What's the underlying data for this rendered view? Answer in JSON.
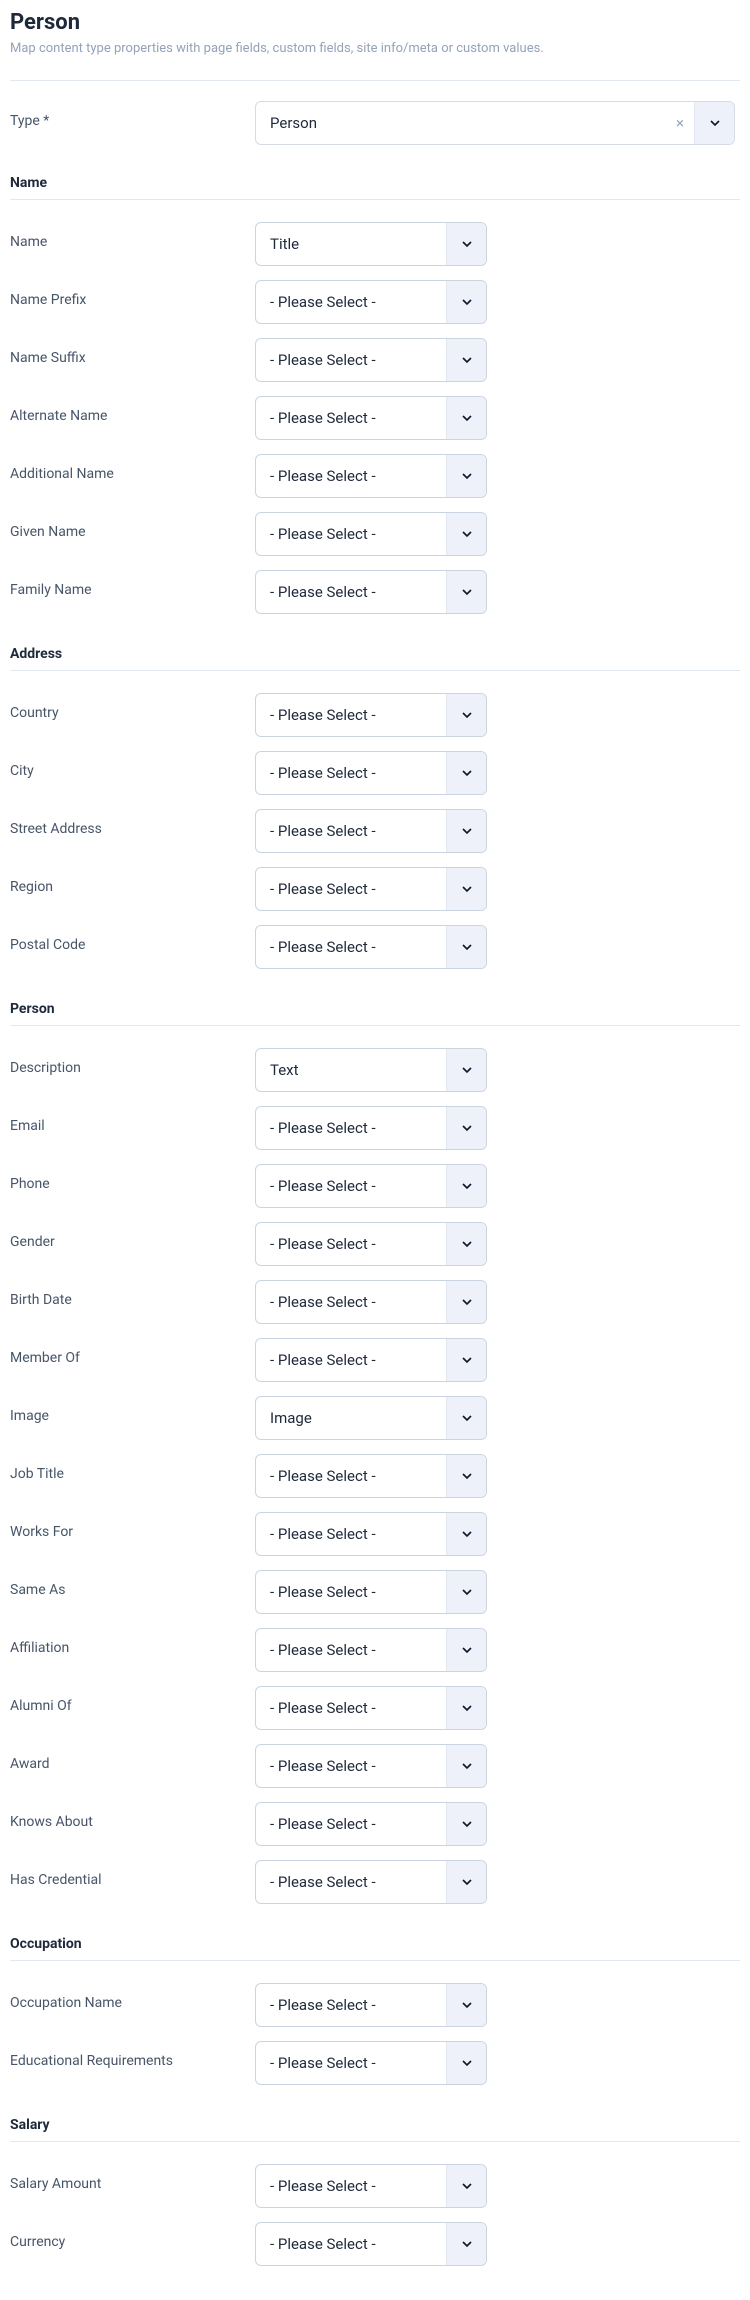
{
  "header": {
    "title": "Person",
    "subtitle": "Map content type properties with page fields, custom fields, site info/meta or custom values."
  },
  "typeRow": {
    "label": "Type *",
    "value": "Person"
  },
  "placeholder": "- Please Select -",
  "sections": [
    {
      "title": "Name",
      "fields": [
        {
          "label": "Name",
          "value": "Title"
        },
        {
          "label": "Name Prefix",
          "value": ""
        },
        {
          "label": "Name Suffix",
          "value": ""
        },
        {
          "label": "Alternate Name",
          "value": ""
        },
        {
          "label": "Additional Name",
          "value": ""
        },
        {
          "label": "Given Name",
          "value": ""
        },
        {
          "label": "Family Name",
          "value": ""
        }
      ]
    },
    {
      "title": "Address",
      "fields": [
        {
          "label": "Country",
          "value": ""
        },
        {
          "label": "City",
          "value": ""
        },
        {
          "label": "Street Address",
          "value": ""
        },
        {
          "label": "Region",
          "value": ""
        },
        {
          "label": "Postal Code",
          "value": ""
        }
      ]
    },
    {
      "title": "Person",
      "fields": [
        {
          "label": "Description",
          "value": "Text"
        },
        {
          "label": "Email",
          "value": ""
        },
        {
          "label": "Phone",
          "value": ""
        },
        {
          "label": "Gender",
          "value": ""
        },
        {
          "label": "Birth Date",
          "value": ""
        },
        {
          "label": "Member Of",
          "value": ""
        },
        {
          "label": "Image",
          "value": "Image"
        },
        {
          "label": "Job Title",
          "value": ""
        },
        {
          "label": "Works For",
          "value": ""
        },
        {
          "label": "Same As",
          "value": ""
        },
        {
          "label": "Affiliation",
          "value": ""
        },
        {
          "label": "Alumni Of",
          "value": ""
        },
        {
          "label": "Award",
          "value": ""
        },
        {
          "label": "Knows About",
          "value": ""
        },
        {
          "label": "Has Credential",
          "value": ""
        }
      ]
    },
    {
      "title": "Occupation",
      "fields": [
        {
          "label": "Occupation Name",
          "value": ""
        },
        {
          "label": "Educational Requirements",
          "value": ""
        }
      ]
    },
    {
      "title": "Salary",
      "fields": [
        {
          "label": "Salary Amount",
          "value": ""
        },
        {
          "label": "Currency",
          "value": ""
        }
      ]
    }
  ]
}
